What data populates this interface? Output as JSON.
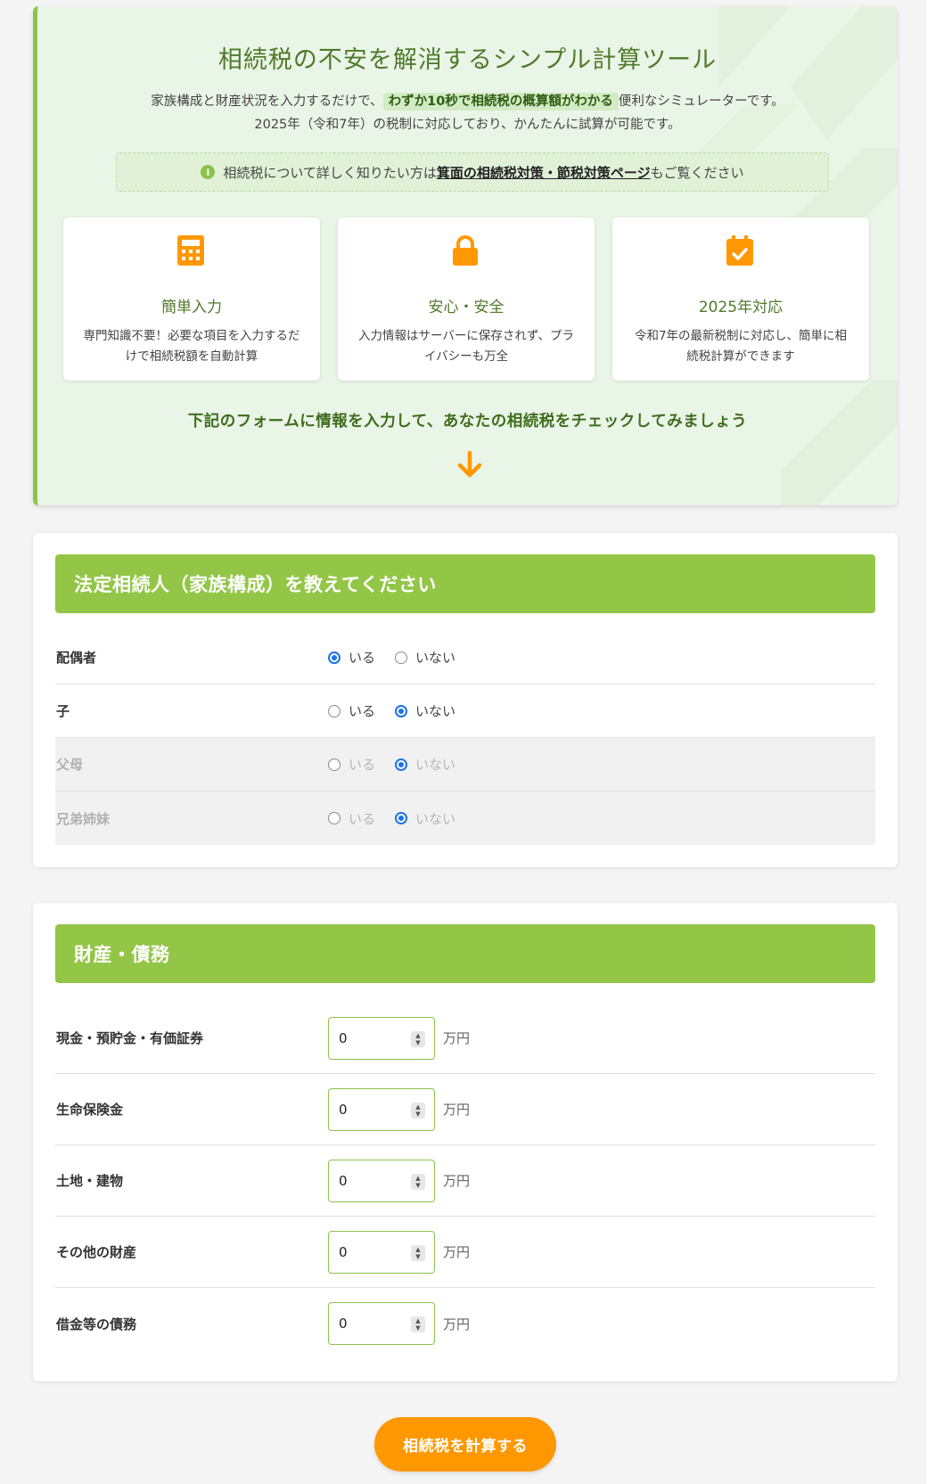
{
  "hero": {
    "title": "相続税の不安を解消するシンプル計算ツール",
    "desc_before": "家族構成と財産状況を入力するだけで、",
    "desc_highlight": "わずか10秒で相続税の概算額がわかる",
    "desc_after": "便利なシミュレーターです。",
    "desc_line2": "2025年（令和7年）の税制に対応しており、かんたんに試算が可能です。",
    "notice_before": "相続税について詳しく知りたい方は",
    "notice_link": "箕面の相続税対策・節税対策ページ",
    "notice_after": "もご覧ください",
    "features": [
      {
        "icon": "calculator-icon",
        "title": "簡単入力",
        "text": "専門知識不要！必要な項目を入力するだけで相続税額を自動計算"
      },
      {
        "icon": "lock-icon",
        "title": "安心・安全",
        "text": "入力情報はサーバーに保存されず、プライバシーも万全"
      },
      {
        "icon": "calendar-check-icon",
        "title": "2025年対応",
        "text": "令和7年の最新税制に対応し、簡単に相続税計算ができます"
      }
    ],
    "cta": "下記のフォームに情報を入力して、あなたの相続税をチェックしてみましょう"
  },
  "heirs": {
    "heading": "法定相続人（家族構成）を教えてください",
    "yes_label": "いる",
    "no_label": "いない",
    "rows": [
      {
        "label": "配偶者",
        "selected": "yes",
        "disabled": false
      },
      {
        "label": "子",
        "selected": "no",
        "disabled": false
      },
      {
        "label": "父母",
        "selected": "no",
        "disabled": true
      },
      {
        "label": "兄弟姉妹",
        "selected": "no",
        "disabled": true
      }
    ]
  },
  "assets": {
    "heading": "財産・債務",
    "unit": "万円",
    "rows": [
      {
        "label": "現金・預貯金・有価証券",
        "value": "0"
      },
      {
        "label": "生命保険金",
        "value": "0"
      },
      {
        "label": "土地・建物",
        "value": "0"
      },
      {
        "label": "その他の財産",
        "value": "0"
      },
      {
        "label": "借金等の債務",
        "value": "0"
      }
    ]
  },
  "calculate_button": "相続税を計算する",
  "colors": {
    "accent_green": "#93c647",
    "dark_green": "#4f7a2a",
    "orange": "#ff9800",
    "radio_blue": "#1a73e8"
  }
}
